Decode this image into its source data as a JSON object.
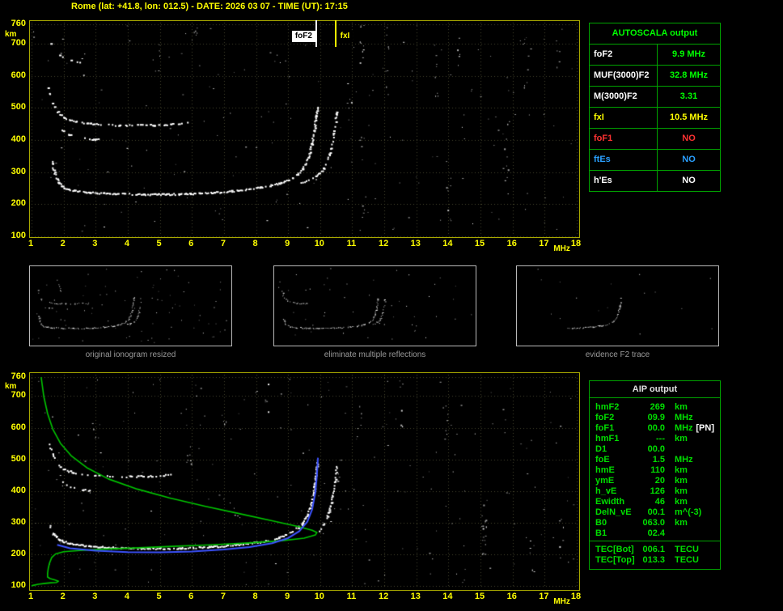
{
  "header": {
    "title": "Rome (lat: +41.8, lon: 012.5) - DATE: 2026 03 07 - TIME (UT): 17:15"
  },
  "colors": {
    "accent_yellow": "#ffff00",
    "plot_border": "#a8a800",
    "grid": "#46462c",
    "trace_white": "#ffffff",
    "profile_green": "#00c400",
    "trace_blue": "#3c52ff",
    "table_border": "#00a400",
    "table_title_green": "#00ff00",
    "aip_text": "#00dd00",
    "status_red": "#ff3232",
    "status_blue": "#2a9fff",
    "caption_gray": "#9a9a9a"
  },
  "autoscala_table": {
    "title": "AUTOSCALA output",
    "rows": [
      {
        "label": "foF2",
        "value": "9.9 MHz",
        "label_color": "#ffffff",
        "value_color": "#00ff00"
      },
      {
        "label": "MUF(3000)F2",
        "value": "32.8 MHz",
        "label_color": "#ffffff",
        "value_color": "#00ff00"
      },
      {
        "label": "M(3000)F2",
        "value": "3.31",
        "label_color": "#ffffff",
        "value_color": "#00ff00"
      },
      {
        "label": "fxI",
        "value": "10.5 MHz",
        "label_color": "#ffff00",
        "value_color": "#ffff00"
      },
      {
        "label": "foF1",
        "value": "NO",
        "label_color": "#ff3232",
        "value_color": "#ff3232"
      },
      {
        "label": "ftEs",
        "value": "NO",
        "label_color": "#2a9fff",
        "value_color": "#2a9fff"
      },
      {
        "label": "h'Es",
        "value": "NO",
        "label_color": "#ffffff",
        "value_color": "#ffffff"
      }
    ]
  },
  "aip_table": {
    "title": "AIP output",
    "rows": [
      {
        "name": "hmF2",
        "value": "269",
        "unit": "km"
      },
      {
        "name": "foF2",
        "value": "09.9",
        "unit": "MHz"
      },
      {
        "name": "foF1",
        "value": "00.0",
        "unit": "MHz",
        "note": "[PN]"
      },
      {
        "name": "hmF1",
        "value": "---",
        "unit": "km"
      },
      {
        "name": "D1",
        "value": "00.0",
        "unit": ""
      },
      {
        "name": "foE",
        "value": "1.5",
        "unit": "MHz"
      },
      {
        "name": "hmE",
        "value": "110",
        "unit": "km"
      },
      {
        "name": "ymE",
        "value": "20",
        "unit": "km"
      },
      {
        "name": "h_vE",
        "value": "126",
        "unit": "km"
      },
      {
        "name": "Ewidth",
        "value": "46",
        "unit": "km"
      },
      {
        "name": "DelN_vE",
        "value": "00.1",
        "unit": "m^(-3)"
      },
      {
        "name": "B0",
        "value": "063.0",
        "unit": "km"
      },
      {
        "name": "B1",
        "value": "02.4",
        "unit": ""
      },
      {
        "name": "TEC[Bot]",
        "value": "006.1",
        "unit": "TECU",
        "section_start": true
      },
      {
        "name": "TEC[Top]",
        "value": "013.3",
        "unit": "TECU"
      }
    ]
  },
  "thumbnails": {
    "panels": [
      {
        "caption": "original ionogram resized",
        "traces": [
          "second-hop-F-trace",
          "second-hop-cusp-trace",
          "third-hop-trace",
          "F2-ordinary-trace",
          "F2-extraordinary-trace"
        ],
        "noise": 85
      },
      {
        "caption": "eliminate multiple reflections",
        "traces": [
          {
            "name": "second-hop-F-trace",
            "clip": [
              1.5,
              3.6
            ]
          },
          "F2-ordinary-trace",
          "F2-extraordinary-trace"
        ],
        "noise": 50
      },
      {
        "caption": "evidence F2 trace",
        "traces": [
          "F2-ordinary-trace"
        ],
        "clip": [
          5.2,
          10.6
        ],
        "noise": 16
      }
    ]
  },
  "chart_data": [
    {
      "id": "ionogram-top",
      "type": "scatter",
      "title": "raw ionogram with autoscaled characteristic frequencies",
      "xlabel": "MHz",
      "ylabel": "km",
      "xlim": [
        1,
        18
      ],
      "ylim": [
        100,
        760
      ],
      "x_ticks": [
        1,
        2,
        3,
        4,
        5,
        6,
        7,
        8,
        9,
        10,
        11,
        12,
        13,
        14,
        15,
        16,
        17,
        18
      ],
      "y_ticks": [
        760,
        700,
        600,
        500,
        400,
        300,
        200,
        100
      ],
      "grid": true,
      "traces": [
        {
          "name": "second-hop-F-trace",
          "density": 0.5,
          "size": 2,
          "points": [
            [
              1.52,
              562
            ],
            [
              1.62,
              520
            ],
            [
              1.8,
              488
            ],
            [
              2.05,
              467
            ],
            [
              2.5,
              456
            ],
            [
              3.1,
              450
            ],
            [
              3.9,
              447
            ],
            [
              4.8,
              448
            ],
            [
              5.4,
              451
            ],
            [
              6.0,
              456
            ]
          ]
        },
        {
          "name": "second-hop-cusp-trace",
          "density": 0.38,
          "size": 2,
          "points": [
            [
              1.95,
              433
            ],
            [
              2.15,
              417
            ],
            [
              2.45,
              409
            ],
            [
              2.75,
              405
            ],
            [
              3.05,
              403
            ]
          ]
        },
        {
          "name": "third-hop-trace",
          "density": 0.15,
          "size": 2,
          "points": [
            [
              1.6,
              700
            ],
            [
              1.8,
              668
            ],
            [
              2.1,
              651
            ],
            [
              2.5,
              643
            ]
          ]
        },
        {
          "name": "F2-ordinary-trace",
          "density": 0.85,
          "size": 2,
          "points": [
            [
              1.62,
              335
            ],
            [
              1.7,
              298
            ],
            [
              1.82,
              270
            ],
            [
              2.0,
              253
            ],
            [
              2.3,
              244
            ],
            [
              2.8,
              238
            ],
            [
              3.6,
              234
            ],
            [
              4.6,
              232
            ],
            [
              5.6,
              233
            ],
            [
              6.6,
              237
            ],
            [
              7.4,
              244
            ],
            [
              8.1,
              253
            ],
            [
              8.7,
              266
            ],
            [
              9.15,
              285
            ],
            [
              9.45,
              312
            ],
            [
              9.62,
              348
            ],
            [
              9.72,
              388
            ],
            [
              9.8,
              432
            ],
            [
              9.86,
              478
            ],
            [
              9.9,
              505
            ]
          ]
        },
        {
          "name": "F2-extraordinary-trace",
          "density": 0.6,
          "size": 2,
          "points": [
            [
              9.35,
              268
            ],
            [
              9.6,
              276
            ],
            [
              9.85,
              289
            ],
            [
              10.05,
              306
            ],
            [
              10.2,
              333
            ],
            [
              10.32,
              372
            ],
            [
              10.4,
              415
            ],
            [
              10.46,
              458
            ],
            [
              10.5,
              495
            ]
          ]
        }
      ],
      "markers": [
        {
          "name": "foF2",
          "label": "foF2",
          "mhz": 9.9,
          "line_color": "#ffffff",
          "label_bg": "#ffffff",
          "label_fg": "#000000",
          "label_side": "left"
        },
        {
          "name": "fxI",
          "label": "fxI",
          "mhz": 10.5,
          "line_color": "#ffff00",
          "label_bg": "#000000",
          "label_fg": "#ffff00",
          "label_side": "right"
        }
      ],
      "noise": {
        "uniform": 175,
        "columns": [
          [
            10.9,
            430,
            530,
            5
          ],
          [
            11.3,
            620,
            760,
            9
          ],
          [
            11.35,
            160,
            420,
            8
          ],
          [
            12.1,
            560,
            760,
            6
          ],
          [
            13.6,
            520,
            700,
            8
          ],
          [
            14.0,
            140,
            300,
            6
          ],
          [
            14.3,
            600,
            720,
            4
          ],
          [
            15.8,
            210,
            480,
            8
          ],
          [
            16.4,
            550,
            720,
            7
          ],
          [
            17.4,
            600,
            760,
            5
          ],
          [
            6.1,
            640,
            760,
            5
          ],
          [
            4.9,
            610,
            700,
            4
          ],
          [
            2.6,
            600,
            680,
            3
          ]
        ]
      }
    },
    {
      "id": "ionogram-bottom",
      "type": "scatter",
      "title": "ionogram with autoscaled F2 trace and electron density profile",
      "xlabel": "MHz",
      "ylabel": "km",
      "xlim": [
        1,
        18
      ],
      "ylim": [
        100,
        760
      ],
      "x_ticks": [
        1,
        2,
        3,
        4,
        5,
        6,
        7,
        8,
        9,
        10,
        11,
        12,
        13,
        14,
        15,
        16,
        17,
        18
      ],
      "y_ticks": [
        760,
        700,
        600,
        500,
        400,
        300,
        200,
        100
      ],
      "grid": true,
      "traces": [
        {
          "name": "second-hop-F-trace",
          "density": 0.45,
          "size": 2,
          "points": [
            [
              1.55,
              548
            ],
            [
              1.7,
              500
            ],
            [
              1.95,
              471
            ],
            [
              2.4,
              457
            ],
            [
              3.0,
              450
            ],
            [
              3.8,
              447
            ],
            [
              4.7,
              449
            ],
            [
              5.4,
              453
            ]
          ]
        },
        {
          "name": "second-hop-cusp-trace",
          "density": 0.32,
          "size": 2,
          "points": [
            [
              1.9,
              431
            ],
            [
              2.15,
              415
            ],
            [
              2.5,
              407
            ],
            [
              2.85,
              403
            ]
          ]
        },
        {
          "name": "F2-ordinary-trace",
          "density": 0.85,
          "size": 2,
          "points": [
            [
              1.55,
              296
            ],
            [
              1.65,
              265
            ],
            [
              1.85,
              247
            ],
            [
              2.2,
              235
            ],
            [
              2.8,
              227
            ],
            [
              3.6,
              222
            ],
            [
              4.6,
              220
            ],
            [
              5.6,
              221
            ],
            [
              6.6,
              225
            ],
            [
              7.4,
              232
            ],
            [
              8.1,
              241
            ],
            [
              8.7,
              254
            ],
            [
              9.1,
              271
            ],
            [
              9.4,
              296
            ],
            [
              9.6,
              329
            ],
            [
              9.72,
              369
            ],
            [
              9.8,
              413
            ],
            [
              9.86,
              459
            ],
            [
              9.9,
              492
            ]
          ]
        },
        {
          "name": "F2-extraordinary-trace",
          "density": 0.55,
          "size": 2,
          "points": [
            [
              9.95,
              272
            ],
            [
              10.1,
              298
            ],
            [
              10.25,
              336
            ],
            [
              10.36,
              383
            ],
            [
              10.44,
              433
            ],
            [
              10.5,
              478
            ]
          ]
        }
      ],
      "autoscaled_trace": {
        "name": "autoscaled-F2-trace",
        "color_key": "trace_blue",
        "points": [
          [
            1.8,
            230
          ],
          [
            2.2,
            219
          ],
          [
            3.0,
            211
          ],
          [
            4.0,
            207
          ],
          [
            5.0,
            206
          ],
          [
            6.0,
            209
          ],
          [
            7.0,
            215
          ],
          [
            7.8,
            223
          ],
          [
            8.5,
            235
          ],
          [
            9.0,
            251
          ],
          [
            9.35,
            273
          ],
          [
            9.6,
            303
          ],
          [
            9.75,
            342
          ],
          [
            9.85,
            396
          ],
          [
            9.9,
            452
          ],
          [
            9.93,
            505
          ]
        ]
      },
      "profile_curve": {
        "name": "electron-density-profile",
        "color_key": "profile_green",
        "points": [
          [
            1.3,
            760
          ],
          [
            1.38,
            700
          ],
          [
            1.5,
            645
          ],
          [
            1.66,
            596
          ],
          [
            1.9,
            551
          ],
          [
            2.25,
            510
          ],
          [
            2.75,
            472
          ],
          [
            3.4,
            438
          ],
          [
            4.3,
            406
          ],
          [
            5.3,
            378
          ],
          [
            6.4,
            352
          ],
          [
            7.5,
            328
          ],
          [
            8.5,
            306
          ],
          [
            9.3,
            288
          ],
          [
            9.75,
            276
          ],
          [
            9.9,
            269
          ],
          [
            9.85,
            261
          ],
          [
            9.5,
            251
          ],
          [
            8.8,
            243
          ],
          [
            7.8,
            236
          ],
          [
            6.6,
            230
          ],
          [
            5.4,
            225
          ],
          [
            4.2,
            220
          ],
          [
            3.2,
            216
          ],
          [
            2.5,
            212
          ],
          [
            2.0,
            208
          ],
          [
            1.75,
            201
          ],
          [
            1.63,
            190
          ],
          [
            1.56,
            172
          ],
          [
            1.52,
            155
          ],
          [
            1.5,
            140
          ],
          [
            1.5,
            128
          ],
          [
            1.58,
            123
          ],
          [
            1.72,
            119
          ],
          [
            1.84,
            115
          ],
          [
            1.78,
            111
          ],
          [
            1.6,
            110
          ],
          [
            1.42,
            108
          ],
          [
            1.2,
            105
          ],
          [
            1.02,
            101
          ],
          [
            1.0,
            100
          ]
        ]
      },
      "noise": {
        "uniform": 200,
        "columns": [
          [
            15.1,
            185,
            365,
            16
          ],
          [
            13.9,
            560,
            720,
            7
          ],
          [
            16.6,
            140,
            260,
            6
          ],
          [
            12.5,
            600,
            760,
            6
          ],
          [
            11.2,
            560,
            700,
            6
          ],
          [
            8.3,
            640,
            760,
            5
          ],
          [
            5.9,
            470,
            520,
            6
          ],
          [
            7.0,
            600,
            660,
            4
          ],
          [
            10.6,
            430,
            520,
            5
          ],
          [
            17.5,
            210,
            310,
            5
          ],
          [
            3.0,
            560,
            620,
            4
          ]
        ]
      }
    }
  ]
}
